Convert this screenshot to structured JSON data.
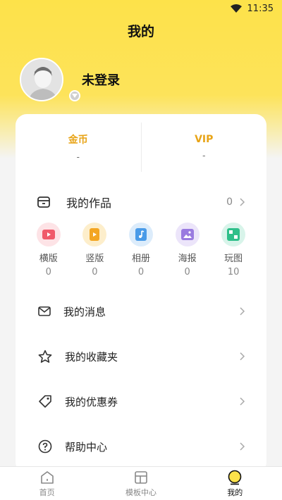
{
  "status": {
    "time": "11:35"
  },
  "header": {
    "title": "我的"
  },
  "profile": {
    "login_text": "未登录"
  },
  "stats": [
    {
      "label": "金币",
      "value": "-"
    },
    {
      "label": "VIP",
      "value": "-"
    }
  ],
  "works": {
    "title": "我的作品",
    "count": "0",
    "items": [
      {
        "label": "横版",
        "value": "0",
        "icon": "horizontal-video-icon",
        "bg": "#fde3e6",
        "fg": "#f05a6a"
      },
      {
        "label": "竖版",
        "value": "0",
        "icon": "vertical-video-icon",
        "bg": "#fdeecb",
        "fg": "#f3a623"
      },
      {
        "label": "相册",
        "value": "0",
        "icon": "album-icon",
        "bg": "#dcecfb",
        "fg": "#4a9be8"
      },
      {
        "label": "海报",
        "value": "0",
        "icon": "poster-icon",
        "bg": "#ece5fa",
        "fg": "#9a7be0"
      },
      {
        "label": "玩图",
        "value": "10",
        "icon": "play-image-icon",
        "bg": "#d8f4ea",
        "fg": "#2fbf8a"
      }
    ]
  },
  "menu": [
    {
      "label": "我的消息",
      "icon": "mail-icon"
    },
    {
      "label": "我的收藏夹",
      "icon": "star-icon"
    },
    {
      "label": "我的优惠券",
      "icon": "coupon-tag-icon"
    },
    {
      "label": "帮助中心",
      "icon": "help-icon"
    }
  ],
  "tabs": [
    {
      "label": "首页",
      "icon": "home-icon",
      "active": false
    },
    {
      "label": "模板中心",
      "icon": "template-icon",
      "active": false
    },
    {
      "label": "我的",
      "icon": "profile-icon",
      "active": true
    }
  ],
  "colors": {
    "accent": "#fde24a",
    "stat_label": "#e8a417"
  }
}
